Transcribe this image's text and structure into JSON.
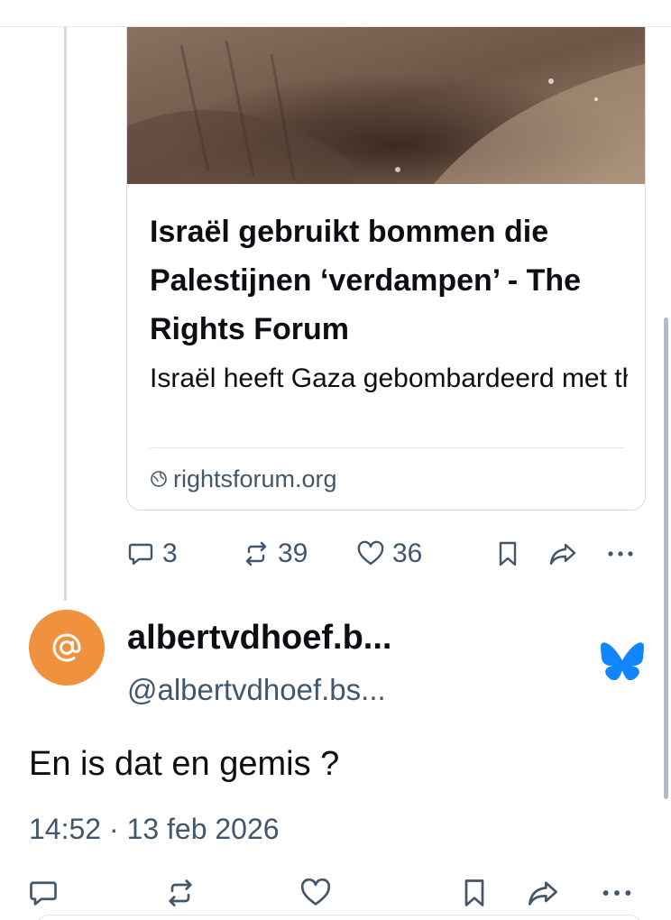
{
  "embed": {
    "title": "Israël gebruikt bommen die Palestijnen ‘verdampen’ - The Rights Forum",
    "description": "Israël heeft Gaza gebombardeerd met thermob...",
    "domain": "rightsforum.org",
    "domain_icon": "globe-icon",
    "image_subject": "bomb crater in sandy ground"
  },
  "parent_post_actions": {
    "replies": "3",
    "reposts": "39",
    "likes": "36"
  },
  "post": {
    "author_display_name": "albertvdhoef.b...",
    "author_handle": "@albertvdhoef.bs...",
    "avatar_symbol": "@",
    "avatar_color": "#f0923d",
    "text": "En is dat en gemis ?",
    "timestamp": "14:52 · 13 feb 2026"
  },
  "colors": {
    "accent": "#1185fe",
    "muted_text": "#42576c",
    "divider": "#d4dbe2"
  },
  "icons": {
    "reply": "reply-icon",
    "repost": "repost-icon",
    "like": "heart-icon",
    "bookmark": "bookmark-icon",
    "share": "share-icon",
    "more": "more-icon",
    "platform": "bluesky-butterfly-icon"
  }
}
